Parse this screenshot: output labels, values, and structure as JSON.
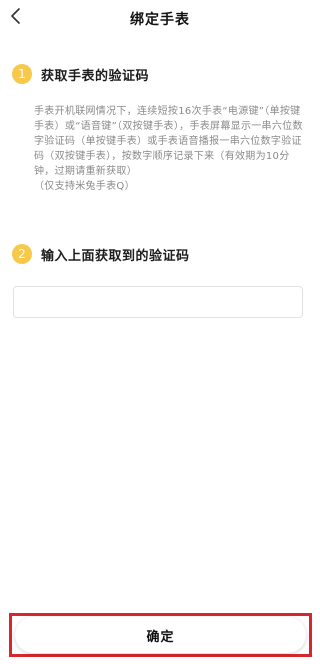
{
  "header": {
    "title": "绑定手表",
    "back_icon": "chevron-left-icon"
  },
  "steps": [
    {
      "number": "1",
      "title": "获取手表的验证码",
      "description": "手表开机联网情况下，连续短按16次手表“电源键”（单按键手表）或“语音键”（双按键手表），手表屏幕显示一串六位数字验证码（单按键手表）或手表语音播报一串六位数字验证码（双按键手表），按数字顺序记录下来（有效期为10分钟，过期请重新获取）",
      "note": "（仅支持米兔手表Q）"
    },
    {
      "number": "2",
      "title": "输入上面获取到的验证码"
    }
  ],
  "code_input": {
    "value": "",
    "placeholder": ""
  },
  "confirm_button": {
    "label": "确定"
  },
  "colors": {
    "badge": "#f7c84a",
    "highlight": "#d7262d",
    "description_text": "#8a8a8a"
  }
}
